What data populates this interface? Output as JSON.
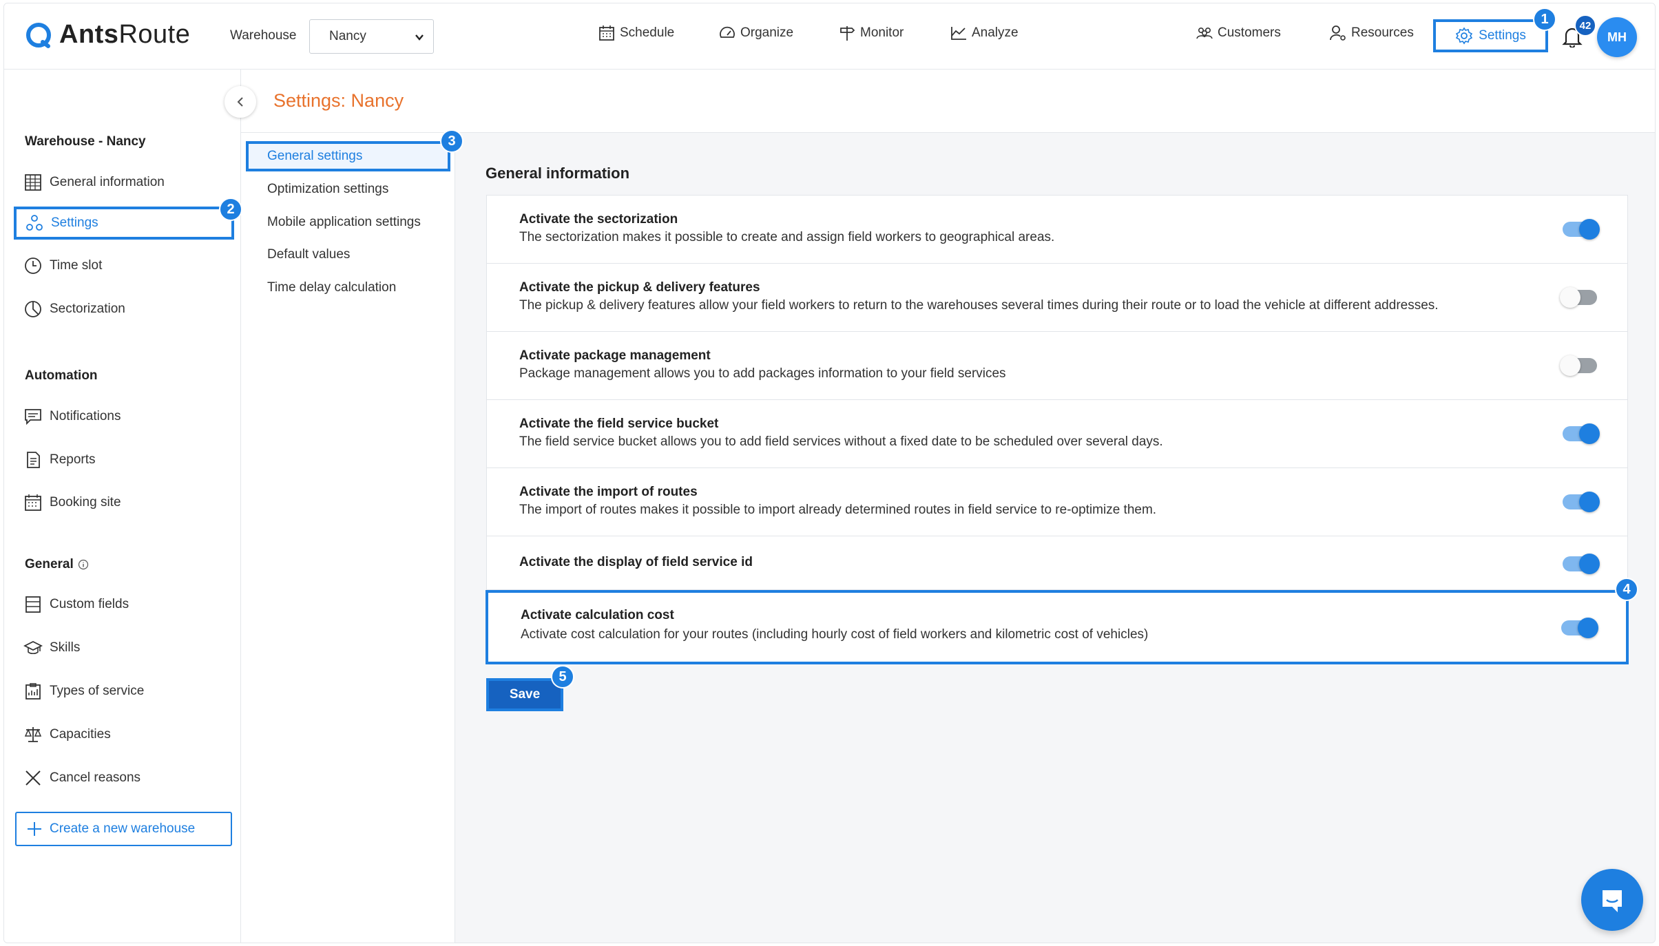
{
  "app": {
    "brand_main": "Ants",
    "brand_sub": "Route"
  },
  "header": {
    "warehouse_label": "Warehouse",
    "warehouse_value": "Nancy",
    "nav": [
      {
        "label": "Schedule",
        "icon": "calendar-icon"
      },
      {
        "label": "Organize",
        "icon": "gauge-icon"
      },
      {
        "label": "Monitor",
        "icon": "signpost-icon"
      },
      {
        "label": "Analyze",
        "icon": "chart-icon"
      },
      {
        "label": "Customers",
        "icon": "users-icon"
      },
      {
        "label": "Resources",
        "icon": "user-gear-icon"
      },
      {
        "label": "Settings",
        "icon": "gear-icon"
      }
    ],
    "notifications_count": "42",
    "avatar_initials": "MH"
  },
  "markers": [
    "1",
    "2",
    "3",
    "4",
    "5"
  ],
  "sidebar": {
    "section_warehouse": "Warehouse - Nancy",
    "warehouse_items": [
      {
        "label": "General information",
        "icon": "grid-icon"
      },
      {
        "label": "Settings",
        "icon": "nodes-icon"
      },
      {
        "label": "Time slot",
        "icon": "clock-icon"
      },
      {
        "label": "Sectorization",
        "icon": "pie-icon"
      }
    ],
    "section_automation": "Automation",
    "automation_items": [
      {
        "label": "Notifications",
        "icon": "message-icon"
      },
      {
        "label": "Reports",
        "icon": "document-icon"
      },
      {
        "label": "Booking site",
        "icon": "calendar-icon"
      }
    ],
    "section_general": "General",
    "general_items": [
      {
        "label": "Custom fields",
        "icon": "fields-icon"
      },
      {
        "label": "Skills",
        "icon": "graduation-cap-icon"
      },
      {
        "label": "Types of service",
        "icon": "clipboard-icon"
      },
      {
        "label": "Capacities",
        "icon": "scale-icon"
      },
      {
        "label": "Cancel reasons",
        "icon": "close-icon"
      }
    ],
    "create_label": "Create a new warehouse"
  },
  "page": {
    "title": "Settings: Nancy"
  },
  "submenu": [
    "General settings",
    "Optimization settings",
    "Mobile application settings",
    "Default values",
    "Time delay calculation"
  ],
  "main": {
    "section_title": "General information",
    "settings": [
      {
        "title": "Activate the sectorization",
        "desc": "The sectorization makes it possible to create and assign field workers to geographical areas.",
        "enabled": true
      },
      {
        "title": "Activate the pickup & delivery features",
        "desc": "The pickup & delivery features allow your field workers to return to the warehouses several times during their route or to load the vehicle at different addresses.",
        "enabled": false
      },
      {
        "title": "Activate package management",
        "desc": "Package management allows you to add packages information to your field services",
        "enabled": false
      },
      {
        "title": "Activate the field service bucket",
        "desc": "The field service bucket allows you to add field services without a fixed date to be scheduled over several days.",
        "enabled": true
      },
      {
        "title": "Activate the import of routes",
        "desc": "The import of routes makes it possible to import already determined routes in field service to re-optimize them.",
        "enabled": true
      },
      {
        "title": "Activate the display of field service id",
        "desc": "",
        "enabled": true
      },
      {
        "title": "Activate calculation cost",
        "desc": "Activate cost calculation for your routes (including hourly cost of field workers and kilometric cost of vehicles)",
        "enabled": true
      }
    ],
    "save_label": "Save"
  },
  "colors": {
    "accent": "#1e7fe0",
    "title_orange": "#e8722c",
    "save_bg": "#1662c0"
  }
}
